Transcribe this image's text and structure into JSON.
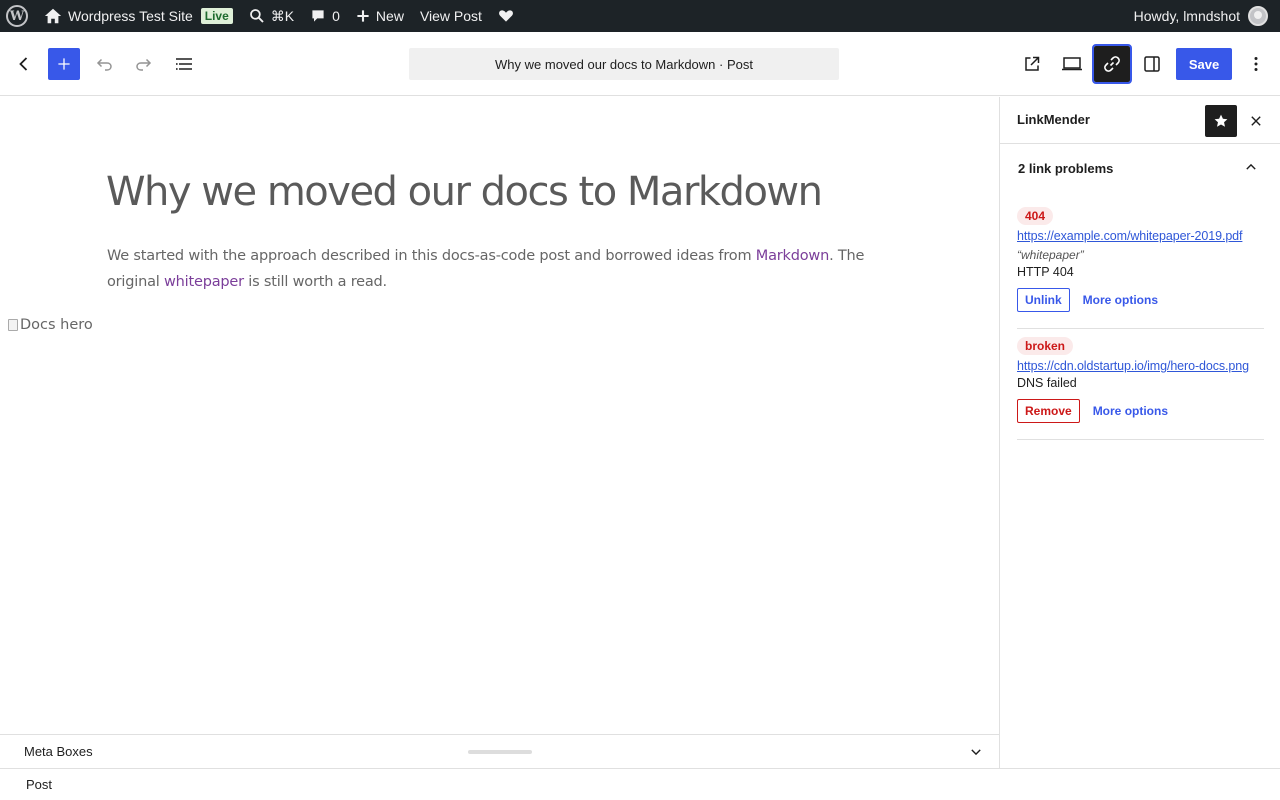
{
  "admin_bar": {
    "site_name": "Wordpress Test Site",
    "live_badge": "Live",
    "search_shortcut": "⌘K",
    "comments_count": "0",
    "new_label": "New",
    "view_post_label": "View Post",
    "greeting": "Howdy, lmndshot"
  },
  "header": {
    "document_title": "Why we moved our docs to Markdown · Post",
    "save_label": "Save"
  },
  "post": {
    "title": "Why we moved our docs to Markdown",
    "paragraph_part1": "We started with the approach described in this docs-as-code post and borrowed ideas from ",
    "link1": "Markdown",
    "paragraph_part2": ". The original ",
    "link2": "whitepaper",
    "paragraph_part3": " is still worth a read.",
    "image_alt": "Docs hero"
  },
  "meta_boxes": {
    "label": "Meta Boxes"
  },
  "footer": {
    "breadcrumb": "Post"
  },
  "sidebar": {
    "title": "LinkMender",
    "panel_title": "2 link problems",
    "issues": [
      {
        "badge": "404",
        "url": "https://example.com/whitepaper-2019.pdf",
        "anchor_text": "“whitepaper”",
        "status": "HTTP 404",
        "action_label": "Unlink",
        "more_label": "More options"
      },
      {
        "badge": "broken",
        "url": "https://cdn.oldstartup.io/img/hero-docs.png",
        "status": "DNS failed",
        "action_label": "Remove",
        "more_label": "More options"
      }
    ]
  },
  "colors": {
    "accent": "#3858e9",
    "admin_bar_bg": "#1d2327",
    "danger": "#cc1818",
    "link_purple": "#7b3e9a",
    "live_badge_bg": "#dff0d8"
  }
}
